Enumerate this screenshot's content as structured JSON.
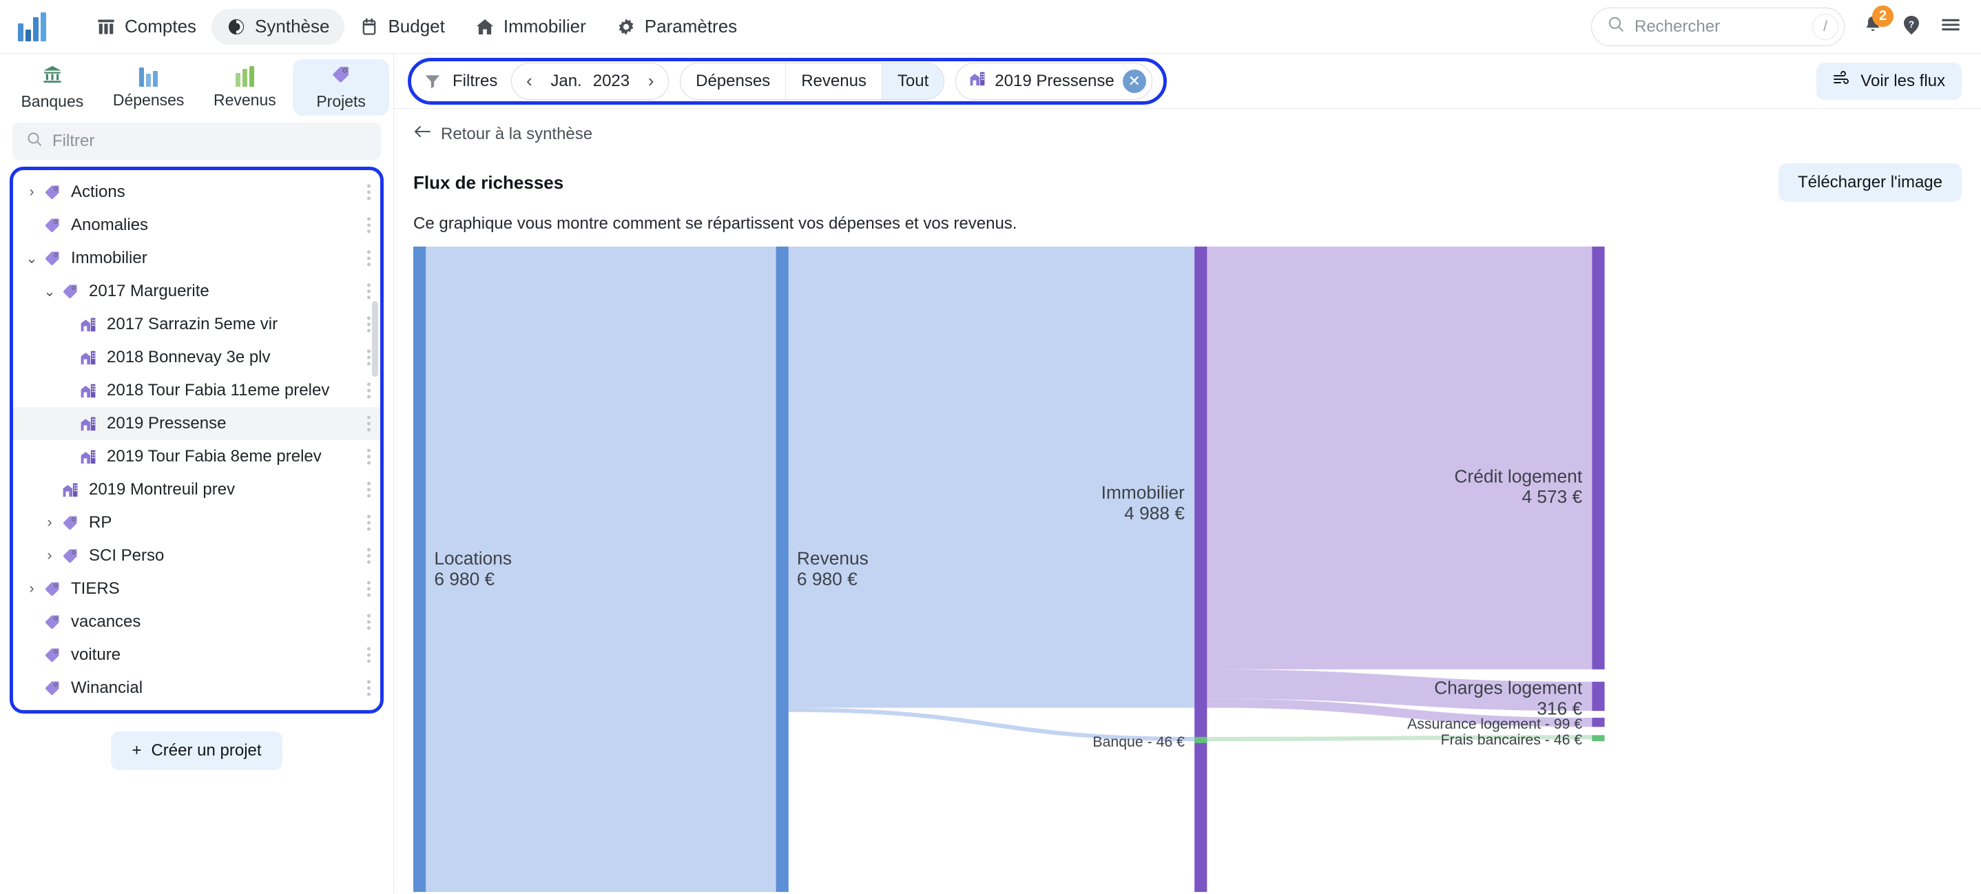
{
  "topnav": {
    "logo": "winancial-logo",
    "items": [
      {
        "label": "Comptes",
        "icon": "columns-icon",
        "active": false
      },
      {
        "label": "Synthèse",
        "icon": "pie-chart-icon",
        "active": true
      },
      {
        "label": "Budget",
        "icon": "calendar-icon",
        "active": false
      },
      {
        "label": "Immobilier",
        "icon": "home-icon",
        "active": false
      },
      {
        "label": "Paramètres",
        "icon": "gear-icon",
        "active": false
      }
    ],
    "search": {
      "placeholder": "Rechercher",
      "value": "",
      "shortcut": "/"
    },
    "notifications_count": "2",
    "help_icon": "help-circle-icon",
    "menu_icon": "hamburger-icon"
  },
  "sidebar": {
    "tabs": [
      {
        "label": "Banques",
        "icon": "bank-icon",
        "active": false
      },
      {
        "label": "Dépenses",
        "icon": "bar-chart-blue-icon",
        "active": false
      },
      {
        "label": "Revenus",
        "icon": "bar-chart-green-icon",
        "active": false
      },
      {
        "label": "Projets",
        "icon": "tag-icon",
        "active": true
      }
    ],
    "filter": {
      "placeholder": "Filtrer",
      "value": ""
    },
    "tree": [
      {
        "label": "Actions",
        "icon": "tag-icon",
        "indent": 0,
        "caret": "collapsed",
        "selected": false
      },
      {
        "label": "Anomalies",
        "icon": "tag-icon",
        "indent": 0,
        "caret": "none",
        "selected": false
      },
      {
        "label": "Immobilier",
        "icon": "tag-icon",
        "indent": 0,
        "caret": "expanded",
        "selected": false
      },
      {
        "label": "2017 Marguerite",
        "icon": "tag-icon",
        "indent": 1,
        "caret": "expanded",
        "selected": false
      },
      {
        "label": "2017 Sarrazin 5eme vir",
        "icon": "building-icon",
        "indent": 2,
        "caret": "none",
        "selected": false
      },
      {
        "label": "2018 Bonnevay 3e plv",
        "icon": "building-icon",
        "indent": 2,
        "caret": "none",
        "selected": false
      },
      {
        "label": "2018 Tour Fabia 11eme prelev",
        "icon": "building-icon",
        "indent": 2,
        "caret": "none",
        "selected": false
      },
      {
        "label": "2019 Pressense",
        "icon": "building-icon",
        "indent": 2,
        "caret": "none",
        "selected": true
      },
      {
        "label": "2019 Tour Fabia 8eme prelev",
        "icon": "building-icon",
        "indent": 2,
        "caret": "none",
        "selected": false
      },
      {
        "label": "2019 Montreuil prev",
        "icon": "building-icon",
        "indent": 1,
        "caret": "none",
        "selected": false
      },
      {
        "label": "RP",
        "icon": "tag-icon",
        "indent": 1,
        "caret": "collapsed",
        "selected": false
      },
      {
        "label": "SCI Perso",
        "icon": "tag-icon",
        "indent": 1,
        "caret": "collapsed",
        "selected": false
      },
      {
        "label": "TIERS",
        "icon": "tag-icon",
        "indent": 0,
        "caret": "collapsed",
        "selected": false
      },
      {
        "label": "vacances",
        "icon": "tag-icon",
        "indent": 0,
        "caret": "none",
        "selected": false
      },
      {
        "label": "voiture",
        "icon": "tag-icon",
        "indent": 0,
        "caret": "none",
        "selected": false
      },
      {
        "label": "Winancial",
        "icon": "tag-icon",
        "indent": 0,
        "caret": "none",
        "selected": false
      }
    ],
    "create_button": {
      "label": "Créer un projet",
      "icon": "plus-icon"
    }
  },
  "filterbar": {
    "icon": "funnel-icon",
    "label": "Filtres",
    "date": {
      "prev_icon": "chevron-left-icon",
      "month": "Jan.",
      "year": "2023",
      "next_icon": "chevron-right-icon"
    },
    "segments": [
      {
        "label": "Dépenses",
        "active": false
      },
      {
        "label": "Revenus",
        "active": false
      },
      {
        "label": "Tout",
        "active": true
      }
    ],
    "project_chip": {
      "icon": "building-icon",
      "label": "2019 Pressense",
      "close_icon": "close-circle-icon"
    },
    "flux_button": {
      "label": "Voir les flux",
      "icon": "wind-icon"
    }
  },
  "page": {
    "back_link": {
      "label": "Retour à la synthèse",
      "icon": "arrow-left-icon"
    },
    "title": "Flux de richesses",
    "download_button": "Télécharger l'image",
    "subtitle": "Ce graphique vous montre comment se répartissent vos dépenses et vos revenus."
  },
  "chart_data": {
    "type": "sankey",
    "title": "Flux de richesses",
    "currency": "€",
    "nodes": [
      {
        "id": "locations",
        "label": "Locations",
        "value": 6980,
        "value_label": "6 980 €",
        "column": 0,
        "color": "#5c8fd6",
        "link_color": "#c3d4f2",
        "label_anchor": "start"
      },
      {
        "id": "revenus",
        "label": "Revenus",
        "value": 6980,
        "value_label": "6 980 €",
        "column": 1,
        "color": "#5c8fd6",
        "link_color": "#c3d4f2",
        "label_anchor": "start"
      },
      {
        "id": "immobilier",
        "label": "Immobilier",
        "value": 4988,
        "value_label": "4 988 €",
        "column": 2,
        "color": "#7b55c4",
        "link_color": "#cfc0ea",
        "label_anchor": "end"
      },
      {
        "id": "banque",
        "label": "Banque",
        "value": 46,
        "value_label": "Banque - 46 €",
        "column": 2,
        "color": "#62c379",
        "link_color": "#cce8d3",
        "label_anchor": "end"
      },
      {
        "id": "credit",
        "label": "Crédit logement",
        "value": 4573,
        "value_label": "4 573 €",
        "column": 3,
        "color": "#7b55c4",
        "link_color": "#cfc0ea",
        "label_anchor": "end"
      },
      {
        "id": "charges",
        "label": "Charges logement",
        "value": 316,
        "value_label": "316 €",
        "column": 3,
        "color": "#7b55c4",
        "link_color": "#cfc0ea",
        "label_anchor": "end"
      },
      {
        "id": "assurance",
        "label": "Assurance logement",
        "value": 99,
        "value_label": "Assurance logement - 99 €",
        "column": 3,
        "color": "#7b55c4",
        "link_color": "#cfc0ea",
        "label_anchor": "end"
      },
      {
        "id": "frais",
        "label": "Frais bancaires",
        "value": 46,
        "value_label": "Frais bancaires - 46 €",
        "column": 3,
        "color": "#62c379",
        "link_color": "#cce8d3",
        "label_anchor": "end"
      }
    ],
    "links": [
      {
        "source": "locations",
        "target": "revenus",
        "value": 6980
      },
      {
        "source": "revenus",
        "target": "immobilier",
        "value": 4988
      },
      {
        "source": "revenus",
        "target": "banque",
        "value": 46
      },
      {
        "source": "immobilier",
        "target": "credit",
        "value": 4573
      },
      {
        "source": "immobilier",
        "target": "charges",
        "value": 316
      },
      {
        "source": "immobilier",
        "target": "assurance",
        "value": 99
      },
      {
        "source": "banque",
        "target": "frais",
        "value": 46
      }
    ]
  },
  "colors": {
    "accent_blue": "#1a35eb",
    "soft_blue_bg": "#e8f2fd",
    "badge_orange": "#f5952b",
    "node_blue": "#5c8fd6",
    "node_purple": "#7b55c4",
    "node_green": "#62c379"
  }
}
